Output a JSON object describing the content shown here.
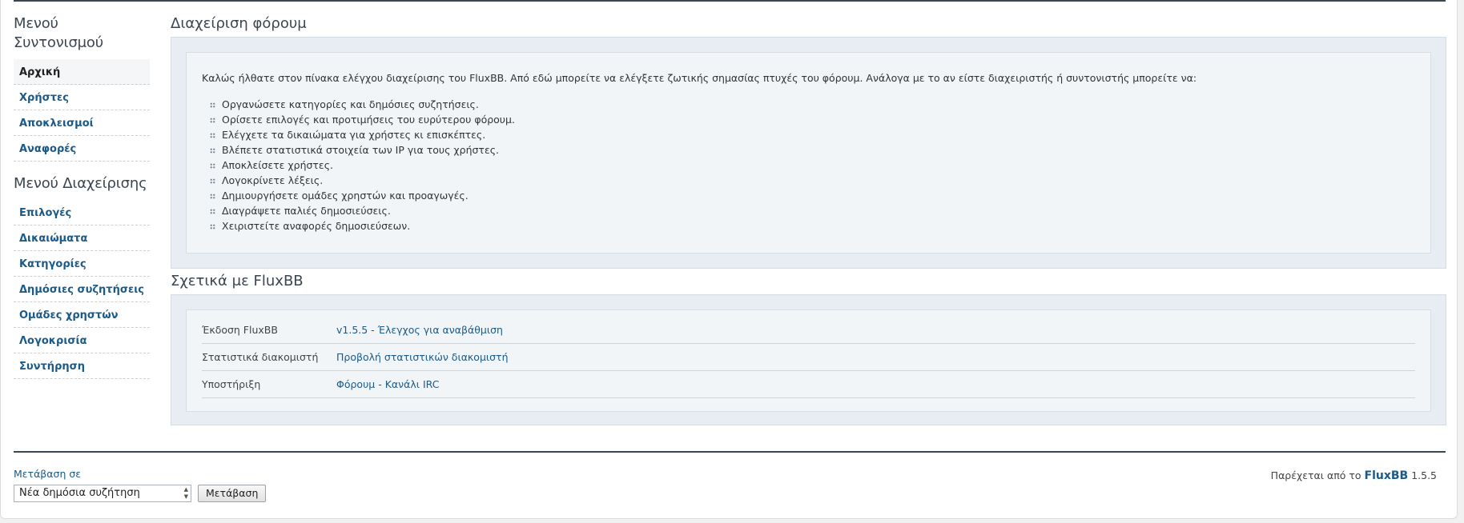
{
  "sidebar": {
    "mod_menu_title": "Μενού Συντονισμού",
    "mod_items": [
      {
        "label": "Αρχική"
      },
      {
        "label": "Χρήστες"
      },
      {
        "label": "Αποκλεισμοί"
      },
      {
        "label": "Αναφορές"
      }
    ],
    "admin_menu_title": "Μενού Διαχείρισης",
    "admin_items": [
      {
        "label": "Επιλογές"
      },
      {
        "label": "Δικαιώματα"
      },
      {
        "label": "Κατηγορίες"
      },
      {
        "label": "Δημόσιες συζητήσεις"
      },
      {
        "label": "Ομάδες χρηστών"
      },
      {
        "label": "Λογοκρισία"
      },
      {
        "label": "Συντήρηση"
      }
    ]
  },
  "admin_section": {
    "title": "Διαχείριση φόρουμ",
    "intro": "Καλώς ήλθατε στον πίνακα ελέγχου διαχείρισης του FluxBB. Από εδώ μπορείτε να ελέγξετε ζωτικής σημασίας πτυχές του φόρουμ. Ανάλογα με το αν είστε διαχειριστής ή συντονιστής μπορείτε να:",
    "items": [
      "Οργανώσετε κατηγορίες και δημόσιες συζητήσεις.",
      "Ορίσετε επιλογές και προτιμήσεις του ευρύτερου φόρουμ.",
      "Ελέγχετε τα δικαιώματα για χρήστες κι επισκέπτες.",
      "Βλέπετε στατιστικά στοιχεία των IP για τους χρήστες.",
      "Αποκλείσετε χρήστες.",
      "Λογοκρίνετε λέξεις.",
      "Δημιουργήσετε ομάδες χρηστών και προαγωγές.",
      "Διαγράψετε παλιές δημοσιεύσεις.",
      "Χειριστείτε αναφορές δημοσιεύσεων."
    ]
  },
  "about_section": {
    "title": "Σχετικά με FluxBB",
    "rows": [
      {
        "label": "Έκδοση FluxBB",
        "value": "v1.5.5 - Έλεγχος για αναβάθμιση"
      },
      {
        "label": "Στατιστικά διακομιστή",
        "value": "Προβολή στατιστικών διακομιστή"
      },
      {
        "label": "Υποστήριξη",
        "value": "Φόρουμ - Κανάλι IRC"
      }
    ]
  },
  "footer": {
    "jump_label": "Μετάβαση σε",
    "jump_selected": "Νέα δημόσια συζήτηση",
    "jump_button": "Μετάβαση",
    "powered_prefix": "Παρέχεται από το",
    "powered_brand": "FluxBB",
    "powered_version": "1.5.5"
  }
}
